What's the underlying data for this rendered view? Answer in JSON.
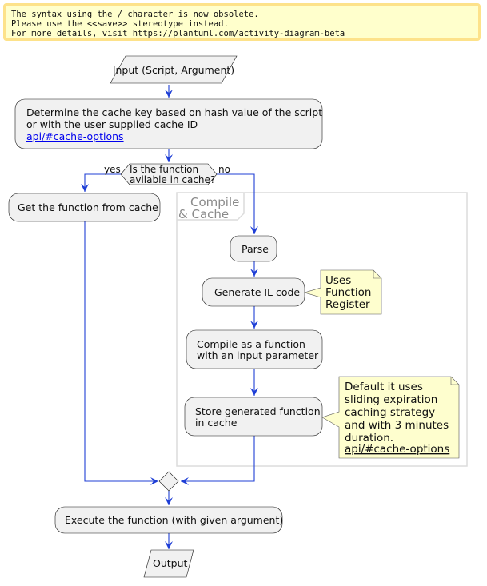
{
  "warning": {
    "lines": [
      "The syntax using the / character is now obsolete.",
      "Please use the <<save>> stereotype instead.",
      "For more details, visit https://plantuml.com/activity-diagram-beta"
    ]
  },
  "diagram": {
    "input": "Input (Script, Argument)",
    "determine": {
      "lines": [
        "Determine the cache key based on hash value of the script",
        "or with the user supplied cache ID"
      ],
      "link": "api/#cache-options"
    },
    "decision": {
      "lines": [
        "Is the function",
        "avilable in cache?"
      ],
      "yes_label": "yes",
      "no_label": "no"
    },
    "get_from_cache": "Get the function from cache",
    "group": {
      "title_lines": [
        "Compile",
        "& Cache"
      ]
    },
    "parse": "Parse",
    "generate_il": "Generate IL code",
    "note_generate": [
      "Uses",
      "Function",
      "Register"
    ],
    "compile": [
      "Compile as a function",
      "with an input parameter"
    ],
    "store": [
      "Store generated function",
      "in cache"
    ],
    "note_store": {
      "lines": [
        "Default it uses",
        "sliding expiration",
        "caching strategy",
        "and with 3 minutes",
        "duration."
      ],
      "link": "api/#cache-options"
    },
    "execute": "Execute the function (with given argument)",
    "output": "Output",
    "colors": {
      "edge": "#1f3fd6",
      "node_fill": "#f1f1f1",
      "note_fill": "#fefece",
      "warning_fill": "#ffffcc",
      "warning_border": "#fde28a",
      "link": "#0000ee"
    }
  }
}
